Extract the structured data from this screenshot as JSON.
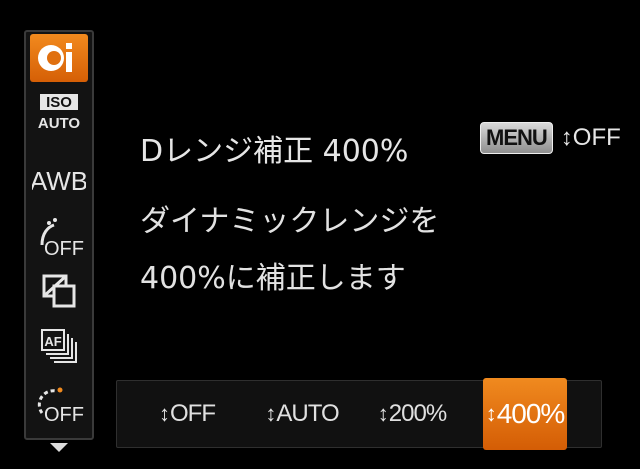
{
  "sidebar": {
    "items": [
      {
        "name": "contrast-correction-icon",
        "label": "Ci",
        "active": true
      },
      {
        "name": "iso-auto-icon",
        "label_top": "ISO",
        "label_bottom": "AUTO"
      },
      {
        "name": "white-balance-icon",
        "label": "AWB"
      },
      {
        "name": "my-colors-icon",
        "label": "OFF"
      },
      {
        "name": "bracketing-icon",
        "label": ""
      },
      {
        "name": "drive-mode-icon",
        "label": "AF"
      },
      {
        "name": "self-timer-icon",
        "label": "OFF"
      }
    ]
  },
  "setting": {
    "title": "Dレンジ補正 400%",
    "menu_button": "MENU",
    "menu_value": "OFF"
  },
  "description": {
    "line1": "ダイナミックレンジを",
    "line2": "400%に補正します"
  },
  "options": [
    {
      "label": "OFF",
      "selected": false
    },
    {
      "label": "AUTO",
      "selected": false
    },
    {
      "label": "200%",
      "selected": false
    },
    {
      "label": "400%",
      "selected": true
    }
  ],
  "colors": {
    "accent": "#e4700f",
    "background": "#000000",
    "text": "#e6e6e6"
  }
}
